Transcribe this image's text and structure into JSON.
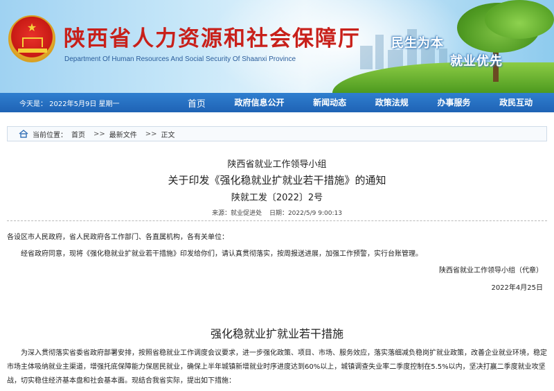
{
  "header": {
    "title": "陕西省人力资源和社会保障厅",
    "subtitle": "Department Of Human Resources And Social Security Of Shaanxi Province",
    "slogan_line1": "民生为本",
    "slogan_line2": "就业优先"
  },
  "navbar": {
    "date": "今天是： 2022年5月9日 星期一",
    "items": [
      "首页",
      "政府信息公开",
      "新闻动态",
      "政策法规",
      "办事服务",
      "政民互动"
    ]
  },
  "breadcrumb": {
    "prefix": "当前位置：",
    "items": [
      "首页",
      "最新文件",
      "正文"
    ],
    "separator": ">>"
  },
  "article": {
    "org": "陕西省就业工作领导小组",
    "title": "关于印发《强化稳就业扩就业若干措施》的通知",
    "doc_no": "陕就工发〔2022〕2号",
    "source": "来源：就业促进处",
    "date": "日期：2022/5/9 9:00:13",
    "addressee": "各设区市人民政府，省人民政府各工作部门、各直属机构，各有关单位：",
    "para1": "经省政府同意，现将《强化稳就业扩就业若干措施》印发给你们，请认真贯彻落实，按周报送进展，加强工作预警，实行台账管理。",
    "sign_org": "陕西省就业工作领导小组（代章）",
    "sign_date": "2022年4月25日",
    "section_title": "强化稳就业扩就业若干措施",
    "para2": "为深入贯彻落实省委省政府部署安排，按照省稳就业工作调度会议要求，进一步强化政策、项目、市场、服务效应，落实落细减负稳岗扩就业政策，改善企业就业环境，稳定市场主体吸纳就业主渠道，增强托底保障能力保居民就业，确保上半年城镇新增就业时序进度达到60%以上，城镇调查失业率二季度控制在5.5%以内，坚决打赢二季度就业攻坚战，切实稳住经济基本盘和社会基本面。现结合我省实际，提出如下措施："
  },
  "colors": {
    "title_red": "#c8201a",
    "nav_blue": "#1f63b5"
  }
}
